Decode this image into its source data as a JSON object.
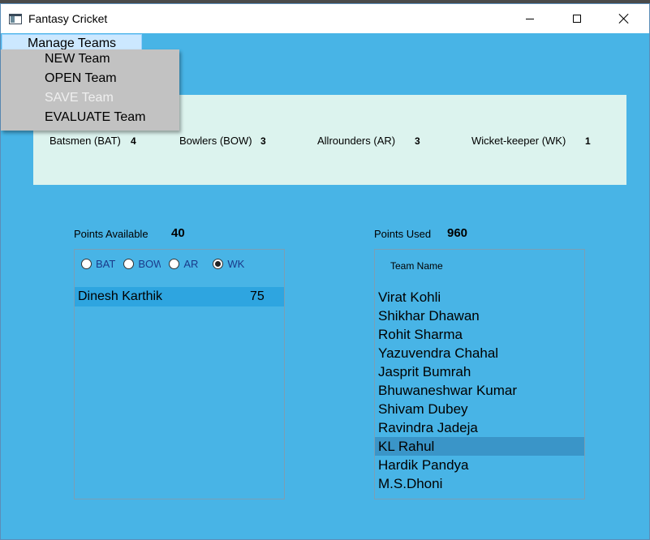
{
  "window": {
    "title": "Fantasy Cricket"
  },
  "menu": {
    "title": "Manage Teams",
    "items": [
      {
        "label": "NEW Team",
        "enabled": true
      },
      {
        "label": "OPEN Team",
        "enabled": true
      },
      {
        "label": "SAVE Team",
        "enabled": false
      },
      {
        "label": "EVALUATE Team",
        "enabled": true
      }
    ]
  },
  "stats": {
    "batsmen": {
      "label": "Batsmen (BAT)",
      "value": "4"
    },
    "bowlers": {
      "label": "Bowlers (BOW)",
      "value": "3"
    },
    "allrounders": {
      "label": "Allrounders (AR)",
      "value": "3"
    },
    "wicketkeeper": {
      "label": "Wicket-keeper (WK)",
      "value": "1"
    }
  },
  "points": {
    "available_label": "Points Available",
    "available_value": "40",
    "used_label": "Points Used",
    "used_value": "960"
  },
  "filter": {
    "options": [
      {
        "label": "BAT",
        "checked": false
      },
      {
        "label": "BOW",
        "checked": false
      },
      {
        "label": "AR",
        "checked": false
      },
      {
        "label": "WK",
        "checked": true
      }
    ]
  },
  "available_players": [
    {
      "name": "Dinesh Karthik",
      "points": "75"
    }
  ],
  "team": {
    "name_label": "Team Name",
    "players": [
      "Virat Kohli",
      "Shikhar Dhawan",
      "Rohit Sharma",
      "Yazuvendra Chahal",
      "Jasprit Bumrah",
      "Bhuwaneshwar Kumar",
      "Shivam Dubey",
      "Ravindra Jadeja",
      "KL Rahul",
      "Hardik Pandya",
      "M.S.Dhoni"
    ],
    "selected": "KL Rahul"
  },
  "colors": {
    "window_bg": "#48b4e6",
    "stats_bg": "#dcf3ee",
    "menu_highlight": "#cce8ff",
    "dropdown_bg": "#c2c2c2",
    "selected_row": "#3a95c8"
  }
}
